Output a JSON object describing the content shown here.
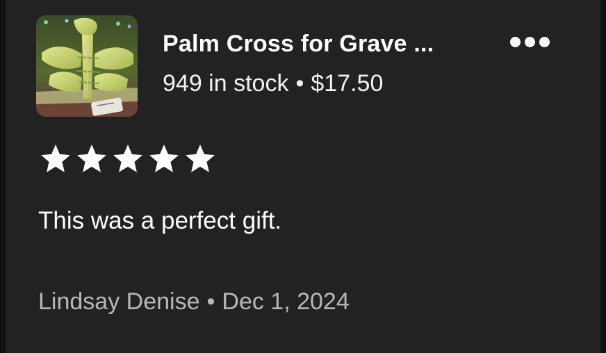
{
  "listing": {
    "image_icon": "palm-cross-photo",
    "title": "Palm Cross for Grave ...",
    "stock": "949 in stock",
    "separator": "•",
    "price": "$17.50"
  },
  "more_menu": {
    "icon": "more-horizontal-icon"
  },
  "review": {
    "rating": 5,
    "rating_max": 5,
    "star_color": "#ffffff",
    "text": "This was a perfect gift.",
    "author": "Lindsay Denise",
    "separator": "•",
    "date": "Dec 1, 2024"
  },
  "colors": {
    "background": "#222222",
    "primary_text": "#ffffff",
    "secondary_text": "#b8b8b8"
  }
}
